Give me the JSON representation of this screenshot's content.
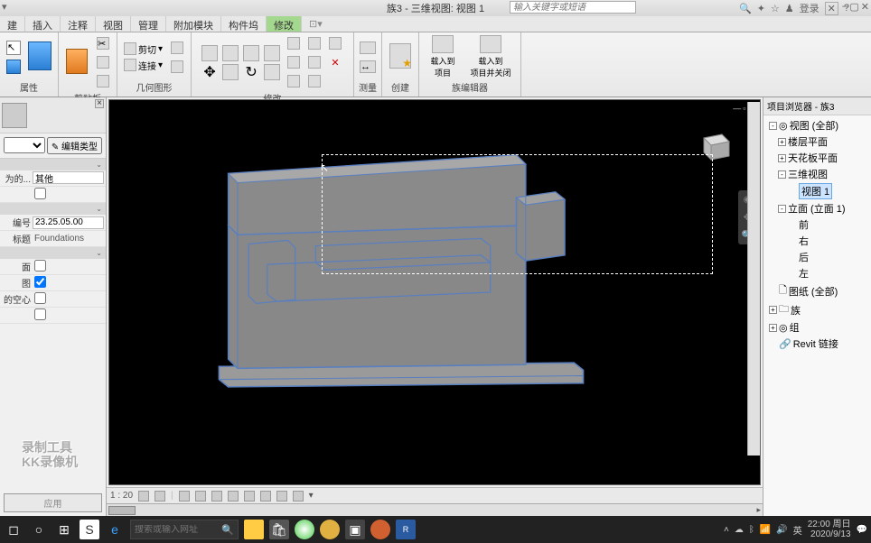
{
  "title": "族3 - 三维视图: 视图 1",
  "search_placeholder": "输入关键字或短语",
  "login_label": "登录",
  "ribbon_tabs": [
    "建",
    "插入",
    "注释",
    "视图",
    "管理",
    "附加模块",
    "构件坞",
    "修改"
  ],
  "ribbon_active_tab": 7,
  "ribbon_groups": {
    "properties": "属性",
    "clipboard": "剪贴板",
    "geometry": "几何图形",
    "modify": "修改",
    "measure": "测量",
    "create": "创建",
    "family_editor": "族编辑器"
  },
  "clipboard_items": {
    "cut": "剪切",
    "copy": "复制",
    "paste": "粘贴"
  },
  "geometry_items": {
    "join": "连接"
  },
  "family_editor_items": {
    "load_project": "载入到\n项目",
    "load_project_close": "载入到\n项目并关闭"
  },
  "properties_panel": {
    "edit_type_btn": "编辑类型",
    "rows": {
      "use_for": {
        "label": "为的...",
        "value": "其他"
      },
      "blank_check": {
        "label": "",
        "checked": false
      },
      "number": {
        "label": "编号",
        "value": "23.25.05.00"
      },
      "category": {
        "label": "标题",
        "value": "Foundations"
      },
      "plane": {
        "label": "面",
        "checked": false
      },
      "view": {
        "label": "图",
        "checked": true
      },
      "void": {
        "label": "的空心",
        "checked": false
      },
      "last": {
        "label": "",
        "checked": false
      }
    },
    "apply": "应用"
  },
  "status": {
    "scale_label": "1 : 20"
  },
  "browser": {
    "title": "项目浏览器 - 族3",
    "root": "视图 (全部)",
    "floor_plan": "楼层平面",
    "ceiling_plan": "天花板平面",
    "three_d": "三维视图",
    "view1": "视图 1",
    "elevation": "立面 (立面 1)",
    "front": "前",
    "right": "右",
    "back": "后",
    "left": "左",
    "sheets": "图纸 (全部)",
    "families": "族",
    "groups": "组",
    "links": "Revit 链接"
  },
  "watermark": {
    "line1": "录制工具",
    "line2": "KK录像机"
  },
  "taskbar": {
    "search_placeholder": "搜索或输入网址",
    "ime": "英",
    "time": "22:00 周日",
    "date": "2020/9/13"
  }
}
